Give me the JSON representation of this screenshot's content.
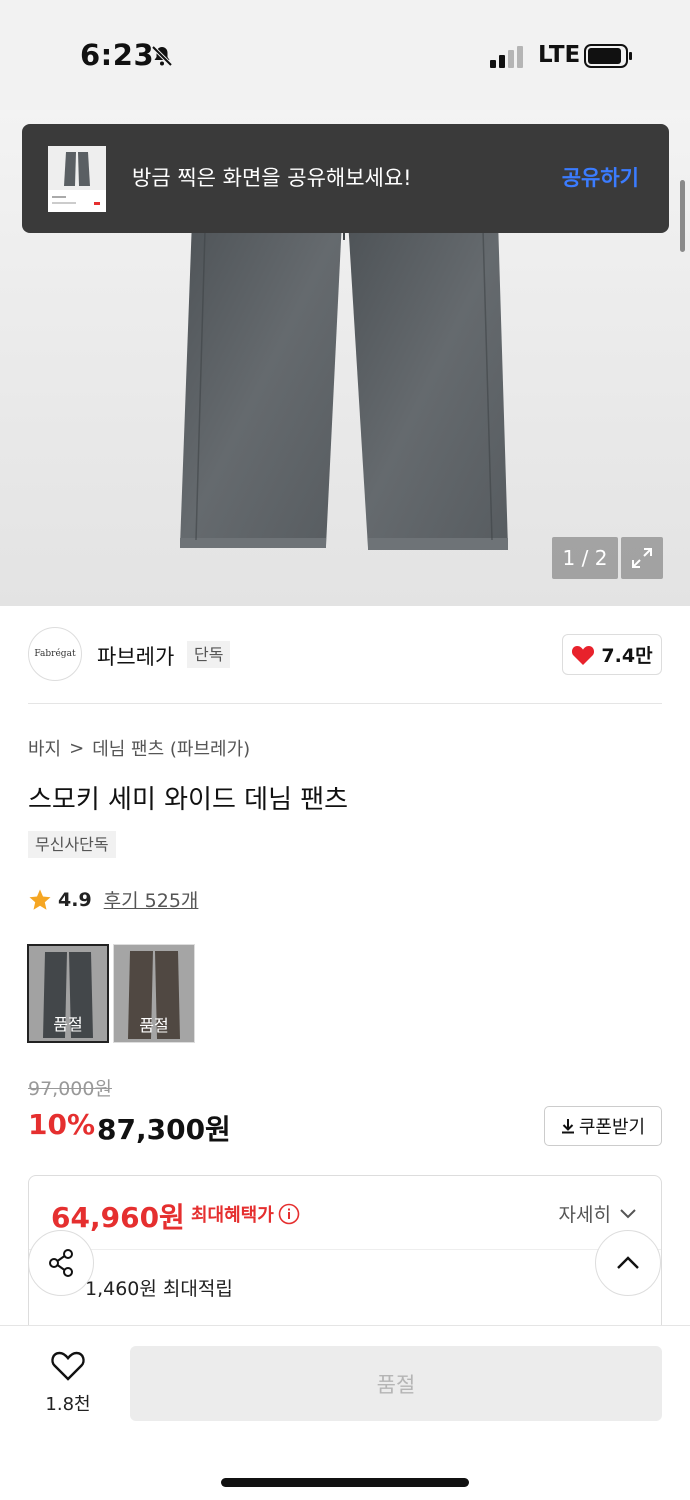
{
  "status_bar": {
    "time": "6:23",
    "network": "LTE"
  },
  "toast": {
    "message": "방금 찍은 화면을 공유해보세요!",
    "action": "공유하기"
  },
  "gallery": {
    "counter": "1 / 2"
  },
  "brand": {
    "logo_text": "Fabrégat",
    "name": "파브레가",
    "badge": "단독",
    "like_count": "7.4만"
  },
  "breadcrumb": {
    "level1": "바지",
    "separator": ">",
    "level2": "데님 팬츠 (파브레가)"
  },
  "product": {
    "title": "스모키 세미 와이드 데님 팬츠",
    "exclusive_badge": "무신사단독",
    "rating": "4.9",
    "review_link": "후기 525개"
  },
  "colors": [
    {
      "label": "품절",
      "swatch": "#6b6f73"
    },
    {
      "label": "품절",
      "swatch": "#6a625a"
    }
  ],
  "price": {
    "original": "97,000원",
    "discount": "10%",
    "sale": "87,300원",
    "coupon_label": "쿠폰받기"
  },
  "benefit": {
    "max_price": "64,960원",
    "max_label": "최대혜택가",
    "detail_label": "자세히",
    "points": "1,460원 최대적립"
  },
  "bottom": {
    "wish_count": "1.8천",
    "buy_label": "품절"
  },
  "colors_ui": {
    "accent_red": "#e52f2f",
    "toast_action": "#3b7cff"
  }
}
